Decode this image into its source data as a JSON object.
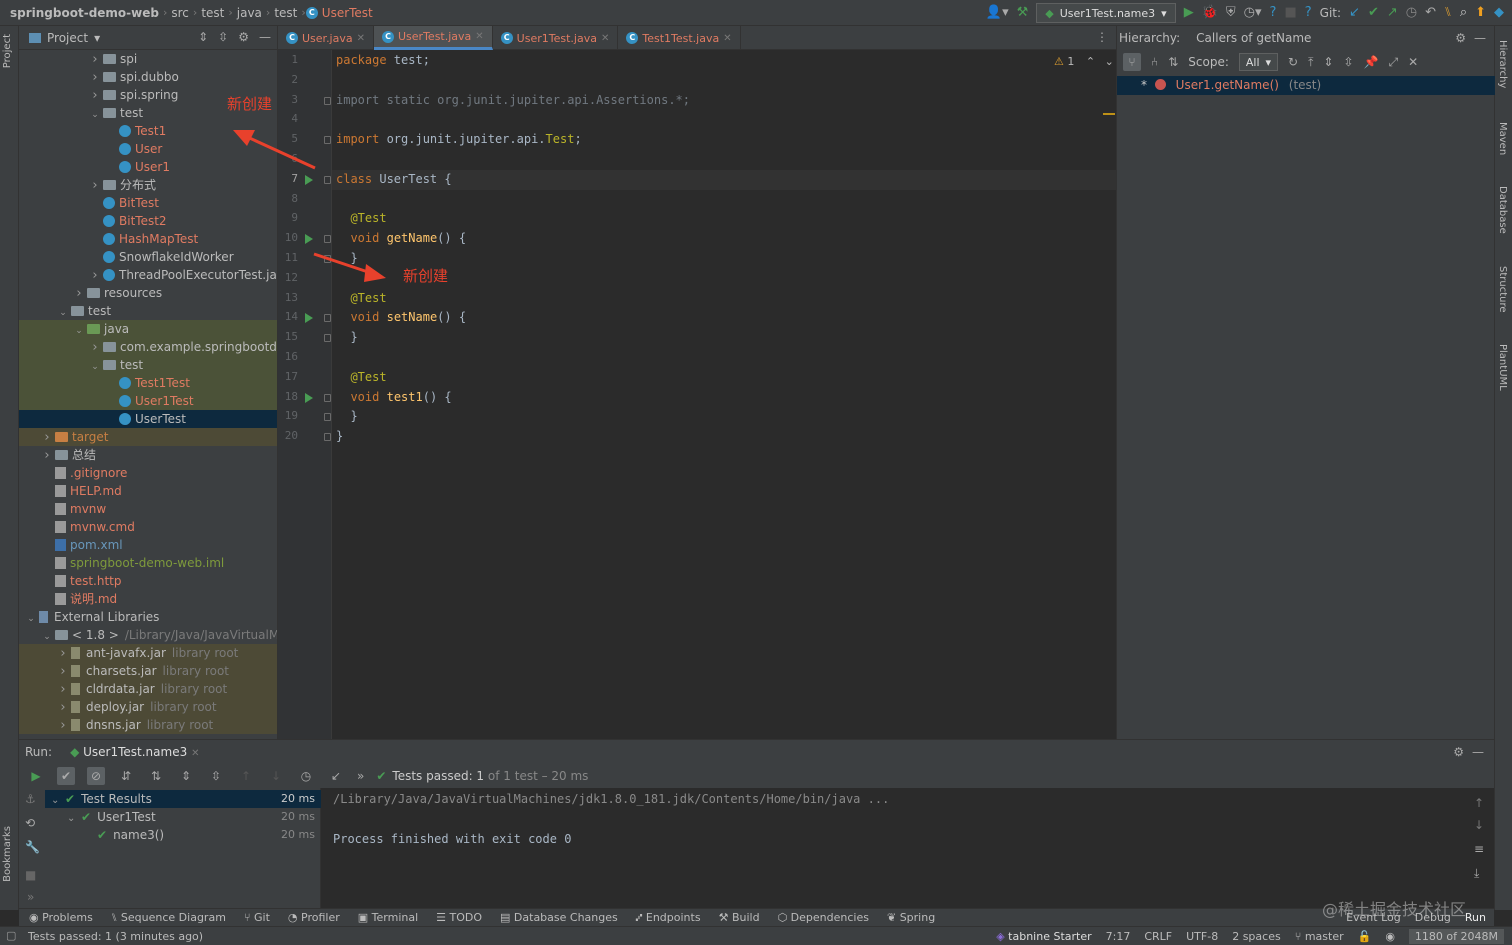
{
  "breadcrumb": {
    "project": "springboot-demo-web",
    "items": [
      "src",
      "test",
      "java",
      "test"
    ],
    "current": "UserTest"
  },
  "toolbar": {
    "run_config": "User1Test.name3",
    "git_label": "Git:"
  },
  "left_stripe": {
    "project_tab": "Project",
    "bookmarks_tab": "Bookmarks"
  },
  "right_stripe": {
    "tabs": [
      "Hierarchy",
      "Maven",
      "Database",
      "Structure",
      "PlantUML"
    ]
  },
  "project_panel": {
    "title": "Project",
    "tree": [
      {
        "label": "spi",
        "kind": "folder",
        "depth": 4,
        "arrow": "right"
      },
      {
        "label": "spi.dubbo",
        "kind": "folder",
        "depth": 4,
        "arrow": "right"
      },
      {
        "label": "spi.spring",
        "kind": "folder",
        "depth": 4,
        "arrow": "right"
      },
      {
        "label": "test",
        "kind": "folder",
        "depth": 4,
        "arrow": "down"
      },
      {
        "label": "Test1",
        "kind": "class",
        "depth": 5,
        "color": "red"
      },
      {
        "label": "User",
        "kind": "class",
        "depth": 5,
        "color": "red"
      },
      {
        "label": "User1",
        "kind": "class",
        "depth": 5,
        "color": "red"
      },
      {
        "label": "分布式",
        "kind": "folder",
        "depth": 4,
        "arrow": "right"
      },
      {
        "label": "BitTest",
        "kind": "class",
        "depth": 4,
        "color": "red"
      },
      {
        "label": "BitTest2",
        "kind": "class",
        "depth": 4,
        "color": "red"
      },
      {
        "label": "HashMapTest",
        "kind": "class",
        "depth": 4,
        "color": "red"
      },
      {
        "label": "SnowflakeIdWorker",
        "kind": "class",
        "depth": 4,
        "color": "normal"
      },
      {
        "label": "ThreadPoolExecutorTest.jav",
        "kind": "class",
        "depth": 4,
        "color": "normal",
        "arrow": "right"
      },
      {
        "label": "resources",
        "kind": "folder",
        "depth": 3,
        "arrow": "right"
      },
      {
        "label": "test",
        "kind": "folder",
        "depth": 2,
        "arrow": "down"
      },
      {
        "label": "java",
        "kind": "folder-green",
        "depth": 3,
        "arrow": "down",
        "bg": "green"
      },
      {
        "label": "com.example.springbootde",
        "kind": "folder",
        "depth": 4,
        "arrow": "right",
        "bg": "green"
      },
      {
        "label": "test",
        "kind": "folder",
        "depth": 4,
        "arrow": "down",
        "bg": "green"
      },
      {
        "label": "Test1Test",
        "kind": "class",
        "depth": 5,
        "color": "red",
        "bg": "green"
      },
      {
        "label": "User1Test",
        "kind": "class",
        "depth": 5,
        "color": "red",
        "bg": "green"
      },
      {
        "label": "UserTest",
        "kind": "class",
        "depth": 5,
        "color": "normal",
        "bg": "selected"
      },
      {
        "label": "target",
        "kind": "folder-orange",
        "depth": 1,
        "arrow": "right",
        "color": "orange",
        "bg": "olive"
      },
      {
        "label": "总结",
        "kind": "folder",
        "depth": 1,
        "arrow": "right"
      },
      {
        "label": ".gitignore",
        "kind": "file",
        "depth": 1,
        "color": "red"
      },
      {
        "label": "HELP.md",
        "kind": "file",
        "depth": 1,
        "color": "red"
      },
      {
        "label": "mvnw",
        "kind": "file",
        "depth": 1,
        "color": "red"
      },
      {
        "label": "mvnw.cmd",
        "kind": "file",
        "depth": 1,
        "color": "red"
      },
      {
        "label": "pom.xml",
        "kind": "maven",
        "depth": 1,
        "color": "blue"
      },
      {
        "label": "springboot-demo-web.iml",
        "kind": "file",
        "depth": 1,
        "color": "olive"
      },
      {
        "label": "test.http",
        "kind": "file",
        "depth": 1,
        "color": "red"
      },
      {
        "label": "说明.md",
        "kind": "file",
        "depth": 1,
        "color": "red"
      },
      {
        "label": "External Libraries",
        "kind": "lib",
        "depth": 0,
        "arrow": "down"
      },
      {
        "label": "< 1.8 >",
        "suffix": "/Library/Java/JavaVirtualMa",
        "kind": "folder",
        "depth": 1,
        "arrow": "down"
      },
      {
        "label": "ant-javafx.jar",
        "suffix": "library root",
        "kind": "jar",
        "depth": 2,
        "arrow": "right",
        "bg": "olive"
      },
      {
        "label": "charsets.jar",
        "suffix": "library root",
        "kind": "jar",
        "depth": 2,
        "arrow": "right",
        "bg": "olive"
      },
      {
        "label": "cldrdata.jar",
        "suffix": "library root",
        "kind": "jar",
        "depth": 2,
        "arrow": "right",
        "bg": "olive"
      },
      {
        "label": "deploy.jar",
        "suffix": "library root",
        "kind": "jar",
        "depth": 2,
        "arrow": "right",
        "bg": "olive"
      },
      {
        "label": "dnsns.jar",
        "suffix": "library root",
        "kind": "jar",
        "depth": 2,
        "arrow": "right",
        "bg": "olive"
      }
    ]
  },
  "editor": {
    "tabs": [
      {
        "label": "User.java",
        "active": false
      },
      {
        "label": "UserTest.java",
        "active": true
      },
      {
        "label": "User1Test.java",
        "active": false
      },
      {
        "label": "Test1Test.java",
        "active": false
      }
    ],
    "warning_count": "1",
    "current_line": 7,
    "lines": [
      {
        "n": 1,
        "html": "<span class='kw'>package</span> test;"
      },
      {
        "n": 2,
        "html": ""
      },
      {
        "n": 3,
        "html": "<span class='imp'>import static org.junit.jupiter.api.Assertions.*;</span>"
      },
      {
        "n": 4,
        "html": ""
      },
      {
        "n": 5,
        "html": "<span class='kw'>import</span> org.junit.jupiter.api.<span class='ann'>Test</span>;"
      },
      {
        "n": 6,
        "html": ""
      },
      {
        "n": 7,
        "html": "<span class='kw'>class</span> UserTest {"
      },
      {
        "n": 8,
        "html": ""
      },
      {
        "n": 9,
        "html": "  <span class='ann'>@Test</span>"
      },
      {
        "n": 10,
        "html": "  <span class='kw'>void</span> <span class='fn'>getName</span>() {"
      },
      {
        "n": 11,
        "html": "  }"
      },
      {
        "n": 12,
        "html": ""
      },
      {
        "n": 13,
        "html": "  <span class='ann'>@Test</span>"
      },
      {
        "n": 14,
        "html": "  <span class='kw'>void</span> <span class='fn'>setName</span>() {"
      },
      {
        "n": 15,
        "html": "  }"
      },
      {
        "n": 16,
        "html": ""
      },
      {
        "n": 17,
        "html": "  <span class='ann'>@Test</span>"
      },
      {
        "n": 18,
        "html": "  <span class='kw'>void</span> <span class='fn'>test1</span>() {"
      },
      {
        "n": 19,
        "html": "  }"
      },
      {
        "n": 20,
        "html": "}"
      }
    ],
    "run_marks": [
      7,
      10,
      14,
      18
    ],
    "annotations": [
      "新创建",
      "新创建"
    ]
  },
  "hierarchy": {
    "title": "Hierarchy:",
    "subtitle": "Callers of getName",
    "scope_label": "Scope:",
    "scope_value": "All",
    "item": "User1.getName()",
    "item_suffix": "(test)"
  },
  "run_panel": {
    "title": "Run:",
    "config_tab": "User1Test.name3",
    "summary_pass": "Tests passed: 1",
    "summary_rest": "of 1 test – 20 ms",
    "tests": [
      {
        "label": "Test Results",
        "duration": "20 ms",
        "depth": 0,
        "selected": true
      },
      {
        "label": "User1Test",
        "duration": "20 ms",
        "depth": 1
      },
      {
        "label": "name3()",
        "duration": "20 ms",
        "depth": 2
      }
    ],
    "console_lines": [
      "/Library/Java/JavaVirtualMachines/jdk1.8.0_181.jdk/Contents/Home/bin/java ...",
      "",
      "Process finished with exit code 0"
    ]
  },
  "tool_windows": [
    "Problems",
    "Sequence Diagram",
    "Git",
    "Profiler",
    "Terminal",
    "TODO",
    "Database Changes",
    "Endpoints",
    "Build",
    "Dependencies",
    "Spring"
  ],
  "tool_windows_right": [
    "Event Log",
    "Debug",
    "Run"
  ],
  "status": {
    "message": "Tests passed: 1 (3 minutes ago)",
    "tabnine": "tabnine Starter",
    "position": "7:17",
    "line_sep": "CRLF",
    "encoding": "UTF-8",
    "indent": "2 spaces",
    "branch": "master",
    "memory": "1180 of 2048M"
  },
  "watermark": "@稀土掘金技术社区",
  "colors": {
    "accent": "#4a88c7",
    "modified": "#e07b62",
    "pass": "#499c54",
    "annotation_red": "#e8412c"
  }
}
